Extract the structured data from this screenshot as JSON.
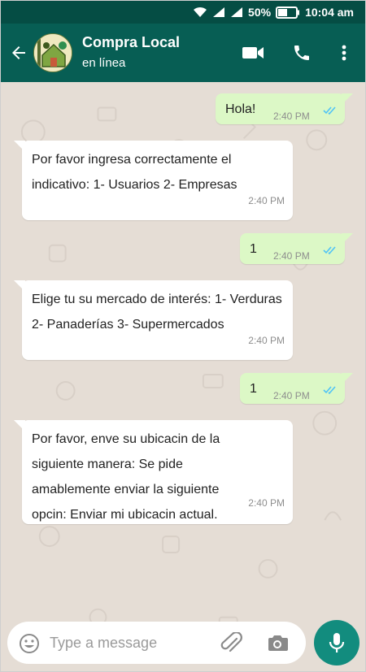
{
  "status_bar": {
    "battery_percent": "50%",
    "time": "10:04 am"
  },
  "header": {
    "title": "Compra Local",
    "subtitle": "en línea"
  },
  "messages": [
    {
      "dir": "out",
      "text": "Hola!",
      "time": "2:40 PM"
    },
    {
      "dir": "in",
      "text": "Por favor ingresa correctamente el indicativo: 1- Usuarios 2- Empresas",
      "time": "2:40 PM"
    },
    {
      "dir": "out",
      "text": "1",
      "time": "2:40 PM"
    },
    {
      "dir": "in",
      "text": "Elige tu su mercado de interés: 1- Verduras 2- Panaderías 3- Supermercados",
      "time": "2:40 PM"
    },
    {
      "dir": "out",
      "text": "1",
      "time": "2:40 PM"
    },
    {
      "dir": "in",
      "text": "Por favor, enve su ubicacin de la siguiente manera: Se pide amablemente enviar la siguiente opcin: Enviar mi ubicacin actual.",
      "time": "2:40 PM"
    }
  ],
  "composer": {
    "placeholder": "Type a message"
  },
  "colors": {
    "header": "#075e54",
    "status_bar": "#054d44",
    "chat_background": "#e5ddd5",
    "outgoing_bubble": "#dcf8c6",
    "incoming_bubble": "#ffffff",
    "read_ticks": "#4fc3f7",
    "mic_button": "#128c7e"
  }
}
